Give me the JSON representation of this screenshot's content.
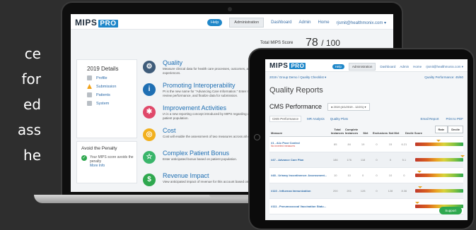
{
  "side_text": [
    "ce",
    "for",
    "ed",
    "ass",
    "he"
  ],
  "laptop": {
    "logo": "MIPS",
    "logo_badge": "PRO",
    "nav": {
      "help": "Help",
      "administration": "Administration",
      "dashboard": "Dashboard",
      "admin": "Admin",
      "home": "Home",
      "user": "rjsmit@healthmonix.com ▾"
    },
    "score_label": "Total MIPS Score",
    "score_value": "78",
    "score_total": "/ 100",
    "details": {
      "title": "2019 Details",
      "items": [
        "Profile",
        "Submission",
        "Patients",
        "System"
      ]
    },
    "penalty": {
      "title": "Avoid the Penalty",
      "text": "Your MIPS score avoids the penalty",
      "more": "More Info"
    },
    "categories": [
      {
        "title": "Quality",
        "desc": "Measure clinical data for health care processes, outcomes, and patient care experiences.",
        "icon": "gear-icon",
        "color": "#3f5c7a"
      },
      {
        "title": "Promoting Interoperability",
        "desc": "PI is the new name for \"Advancing Care Information.\" Enter measure data, review performance, and finalize data for submission.",
        "icon": "info-icon",
        "color": "#1f6fb3"
      },
      {
        "title": "Improvement Activities",
        "desc": "IA is a new reporting concept introduced by MIPS regarding activities related to patient population.",
        "icon": "cogs-icon",
        "color": "#e0496a"
      },
      {
        "title": "Cost",
        "desc": "Cost will enable the assessment of two measures across all eligible clinicians.",
        "icon": "coin-icon",
        "color": "#f2b01e"
      },
      {
        "title": "Complex Patient Bonus",
        "desc": "Enter anticipated bonus based on patient population.",
        "icon": "star-icon",
        "color": "#39b56a"
      },
      {
        "title": "Revenue Impact",
        "desc": "View anticipated impact of revenue for this account based on",
        "icon": "money-icon",
        "color": "#2fa84f"
      }
    ]
  },
  "tablet": {
    "logo": "MIPS",
    "logo_badge": "PRO",
    "nav": {
      "help": "Help",
      "administration": "Administration",
      "dashboard": "Dashboard",
      "admin": "Admin",
      "home": "Home",
      "user": "rjsmit@healthmonix.com ▾"
    },
    "breadcrumb": "2019  /  Group Demo  /  Quality Checklist ▾",
    "performance_link": "Quality Performance: 45/60",
    "title": "Quality Reports",
    "cms_title": "CMS Performance",
    "cms_select": "● 2019 (4/1/2019 - 12/2/1) ▾",
    "tabs": [
      "CMS Performance",
      "MR Analysis",
      "Quality Plots"
    ],
    "actions": [
      "Email Report",
      "Print to PDF"
    ],
    "columns": [
      "Measure",
      "Total Instances",
      "Complete Instances",
      "Met",
      "Exclusions",
      "Not Met",
      "Decile Score"
    ],
    "toggle": [
      "Rate",
      "Decile"
    ],
    "rows": [
      {
        "name": "#1 - A1c Poor Control",
        "sub": "No inverted measures",
        "vals": [
          "85",
          "84",
          "19",
          "0",
          "15",
          "6.21"
        ]
      },
      {
        "name": "#47 - Advance Care Plan",
        "sub": "",
        "vals": [
          "186",
          "176",
          "118",
          "0",
          "0",
          "5.1"
        ]
      },
      {
        "name": "#48 - Urinary Incontinence: Assessment...",
        "sub": "",
        "vals": [
          "10",
          "10",
          "0",
          "0",
          "10",
          "0"
        ]
      },
      {
        "name": "#110 - Influenza Immunization",
        "sub": "",
        "vals": [
          "200",
          "201",
          "128",
          "0",
          "128",
          "8.36"
        ]
      },
      {
        "name": "#111 - Pneumococcal Vaccination Statu...",
        "sub": "",
        "vals": [
          "",
          "",
          "",
          "",
          "",
          ""
        ]
      }
    ],
    "decile_marks": [
      0.48,
      0.99,
      0.08,
      0.1,
      0.04
    ],
    "support": "Support"
  }
}
